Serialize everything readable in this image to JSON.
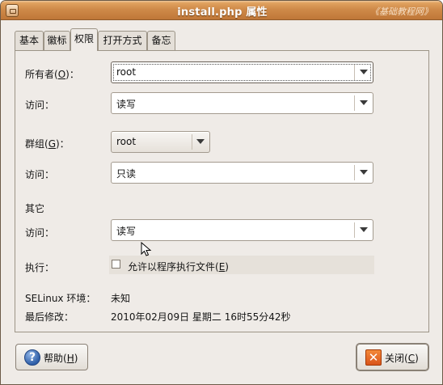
{
  "window": {
    "title": "install.php 属性",
    "watermark": "《基础教程网》"
  },
  "tabs": [
    {
      "label": "基本",
      "active": false
    },
    {
      "label": "徽标",
      "active": false
    },
    {
      "label": "权限",
      "active": true
    },
    {
      "label": "打开方式",
      "active": false
    },
    {
      "label": "备忘",
      "active": false
    }
  ],
  "permissions": {
    "owner": {
      "label_pre": "所有者(",
      "mnemonic": "O",
      "label_post": ")：",
      "value": "root"
    },
    "owner_access": {
      "label": "访问：",
      "value": "读写"
    },
    "group": {
      "label_pre": "群组(",
      "mnemonic": "G",
      "label_post": ")：",
      "value": "root"
    },
    "group_access": {
      "label": "访问：",
      "value": "只读"
    },
    "others_heading": "其它",
    "others_access": {
      "label": "访问：",
      "value": "读写"
    },
    "execute": {
      "label": "执行：",
      "checkbox_label_pre": "允许以程序执行文件(",
      "mnemonic": "E",
      "checkbox_label_post": ")",
      "checked": false
    },
    "selinux": {
      "label": "SELinux 环境：",
      "value": "未知"
    },
    "modified": {
      "label": "最后修改：",
      "value": "2010年02月09日 星期二 16时55分42秒"
    }
  },
  "buttons": {
    "help": {
      "label_pre": "帮助(",
      "mnemonic": "H",
      "label_post": ")",
      "icon": "help-icon"
    },
    "close": {
      "label_pre": "关闭(",
      "mnemonic": "C",
      "label_post": ")",
      "icon": "close-icon"
    }
  }
}
